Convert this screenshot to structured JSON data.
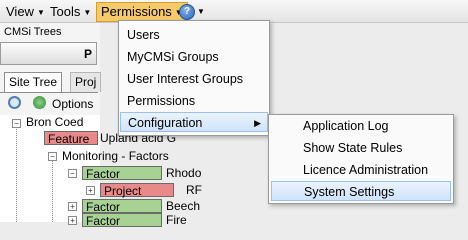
{
  "menubar": {
    "view_label": "View",
    "tools_label": "Tools",
    "permissions_label": "Permissions",
    "help_icon": "help-icon"
  },
  "left_panel": {
    "section_title": "CMSi Trees",
    "button_partial": "P",
    "tabs": [
      {
        "label": "Site Tree"
      },
      {
        "label": "Proj"
      }
    ],
    "options_label": "Options"
  },
  "tree": {
    "root": "Bron Coed",
    "items": [
      {
        "type": "Feature",
        "label": "Upland acid G"
      },
      {
        "label": "Monitoring - Factors"
      },
      {
        "type": "Factor",
        "label": "Rhodo"
      },
      {
        "type": "Project",
        "label": "RF"
      },
      {
        "type": "Factor",
        "label": "Beech"
      },
      {
        "type": "Factor",
        "label": "Fire"
      }
    ]
  },
  "permissions_menu": {
    "items": [
      {
        "label": "Users"
      },
      {
        "label": "MyCMSi Groups"
      },
      {
        "label": "User Interest Groups"
      },
      {
        "label": "Permissions"
      },
      {
        "label": "Configuration"
      }
    ]
  },
  "configuration_submenu": {
    "items": [
      {
        "label": "Application Log"
      },
      {
        "label": "Show State Rules"
      },
      {
        "label": "Licence Administration"
      },
      {
        "label": "System Settings"
      }
    ]
  },
  "colors": {
    "active_menu": "#f6ca6b",
    "highlight": "#cfe3fa",
    "feature_tag": "#e88a8a",
    "project_tag": "#e88a8a",
    "factor_tag": "#a8d294"
  }
}
